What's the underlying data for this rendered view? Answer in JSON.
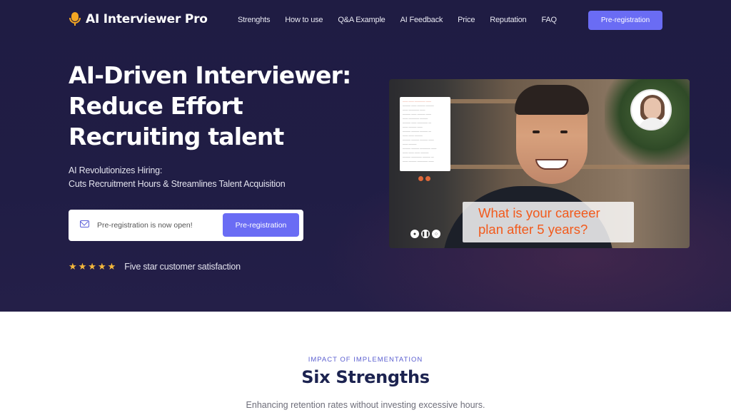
{
  "brand": {
    "name": "AI Interviewer Pro",
    "accent": "#6a6cf4",
    "hero_bg": "#201d45"
  },
  "nav": {
    "items": [
      {
        "label": "Strenghts"
      },
      {
        "label": "How to use"
      },
      {
        "label": "Q&A Example"
      },
      {
        "label": "AI Feedback"
      },
      {
        "label": "Price"
      },
      {
        "label": "Reputation"
      },
      {
        "label": "FAQ"
      }
    ],
    "cta_label": "Pre-registration"
  },
  "hero": {
    "headline_lines": [
      "AI-Driven Interviewer:",
      "Reduce Effort",
      "Recruiting talent"
    ],
    "sub_lines": [
      "AI Revolutionizes Hiring:",
      "Cuts Recruitment Hours & Streamlines Talent Acquisition"
    ],
    "signup": {
      "placeholder": "Pre-registration is now open!",
      "button_label": "Pre-registration"
    },
    "rating": {
      "stars": "★★★★★",
      "text": "Five star customer satisfaction"
    }
  },
  "video": {
    "caption_lines": [
      "What is your careeer",
      "plan after 5 years?"
    ]
  },
  "section": {
    "eyebrow": "IMPACT OF IMPLEMENTATION",
    "title": "Six Strengths",
    "subtitle": "Enhancing retention rates without investing excessive hours."
  }
}
